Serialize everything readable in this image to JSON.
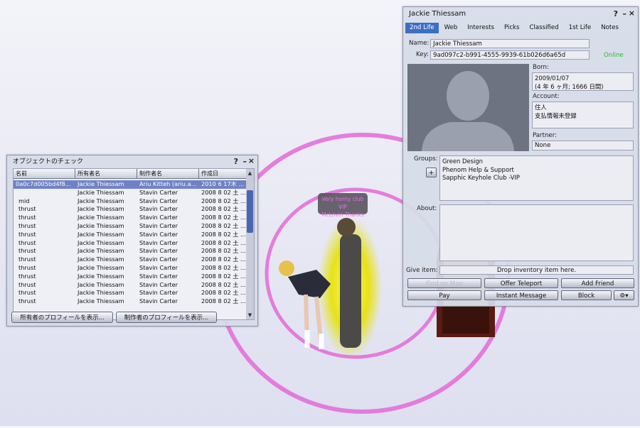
{
  "scene": {
    "tag_line1": "Very horny club VIP",
    "tag_line2": "McLovin Thanks"
  },
  "object_check": {
    "title": "オブジェクトのチェック",
    "headers": [
      "名前",
      "所有者名",
      "制作者名",
      "作成日"
    ],
    "rows": [
      [
        "0a0c7d005bd4f8...",
        "Jackie Thiessam",
        "Ariu Kitteh (ariu.a...",
        "2010 6 17木 ..."
      ],
      [
        "",
        "Jackie Thiessam",
        "Stavin Carter",
        "2008 8 02 土 ..."
      ],
      [
        "mid",
        "Jackie Thiessam",
        "Stavin Carter",
        "2008 8 02 土 ..."
      ],
      [
        "thrust",
        "Jackie Thiessam",
        "Stavin Carter",
        "2008 8 02 土 ..."
      ],
      [
        "thrust",
        "Jackie Thiessam",
        "Stavin Carter",
        "2008 8 02 土 ..."
      ],
      [
        "thrust",
        "Jackie Thiessam",
        "Stavin Carter",
        "2008 8 02 土 ..."
      ],
      [
        "thrust",
        "Jackie Thiessam",
        "Stavin Carter",
        "2008 8 02 土 ..."
      ],
      [
        "thrust",
        "Jackie Thiessam",
        "Stavin Carter",
        "2008 8 02 土 ..."
      ],
      [
        "thrust",
        "Jackie Thiessam",
        "Stavin Carter",
        "2008 8 02 土 ..."
      ],
      [
        "thrust",
        "Jackie Thiessam",
        "Stavin Carter",
        "2008 8 02 土 ..."
      ],
      [
        "thrust",
        "Jackie Thiessam",
        "Stavin Carter",
        "2008 8 02 土 ..."
      ],
      [
        "thrust",
        "Jackie Thiessam",
        "Stavin Carter",
        "2008 8 02 土 ..."
      ],
      [
        "thrust",
        "Jackie Thiessam",
        "Stavin Carter",
        "2008 8 02 土 ..."
      ],
      [
        "thrust",
        "Jackie Thiessam",
        "Stavin Carter",
        "2008 8 02 土 ..."
      ],
      [
        "thrust",
        "Jackie Thiessam",
        "Stavin Carter",
        "2008 8 02 土 ..."
      ]
    ],
    "button_owner": "所有者のプロフィールを表示...",
    "button_creator": "制作者のプロフィールを表示..."
  },
  "profile": {
    "title": "Jackie Thiessam",
    "tabs": [
      "2nd Life",
      "Web",
      "Interests",
      "Picks",
      "Classified",
      "1st Life",
      "Notes"
    ],
    "name_label": "Name:",
    "name_value": "Jackie Thiessam",
    "key_label": "Key:",
    "key_value": "9ad097c2-b991-4555-9939-61b026d6a65d",
    "status": "Online",
    "born_label": "Born:",
    "born_line1": "2009/01/07",
    "born_line2": "(4 年 6 ヶ月; 1666 日間)",
    "account_label": "Account:",
    "account_line1": "住人",
    "account_line2": "支払情報未登録",
    "partner_label": "Partner:",
    "partner_value": "None",
    "groups_label": "Groups:",
    "groups": [
      "Green Design",
      "Phenom Help & Support",
      "Sapphic Keyhole Club -VIP"
    ],
    "add_group": "+",
    "about_label": "About:",
    "give_item_label": "Give item:",
    "give_item_text": "Drop inventory item here.",
    "buttons": {
      "find_on_map": "Find on Map",
      "offer_teleport": "Offer Teleport",
      "add_friend": "Add Friend",
      "pay": "Pay",
      "instant_message": "Instant Message",
      "block": "Block",
      "gear": "⚙▾"
    },
    "colors": {
      "online": "#22c022",
      "active_tab": "#3c6fc2"
    }
  },
  "window_controls": {
    "help": "?",
    "minimize": "–",
    "close": "×"
  }
}
